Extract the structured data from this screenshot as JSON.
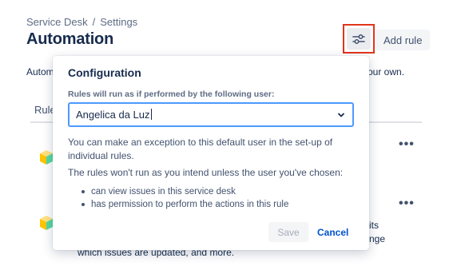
{
  "breadcrumb": {
    "project": "Service Desk",
    "separator": "/",
    "page": "Settings"
  },
  "title": "Automation",
  "header": {
    "add_rule_label": "Add rule",
    "settings_icon": "sliders-icon"
  },
  "intro": {
    "left": "Autom",
    "right": "our own."
  },
  "tabs": {
    "left": "Rule"
  },
  "background": {
    "line1": "its",
    "line2": "nge",
    "line3": "which issues are updated, and more."
  },
  "dialog": {
    "title": "Configuration",
    "field_label": "Rules will run as if performed by the following user:",
    "selected_user": "Angelica da Luz",
    "help_text": "You can make an exception to this default user in the set-up of individual rules.",
    "warning": "The rules won't run as you intend unless the user you've chosen:",
    "bullets": [
      "can view issues in this service desk",
      "has permission to perform the actions in this rule"
    ],
    "save_label": "Save",
    "cancel_label": "Cancel"
  },
  "colors": {
    "accent": "#0052cc",
    "focus": "#4c9aff",
    "highlight": "#e2341d"
  }
}
